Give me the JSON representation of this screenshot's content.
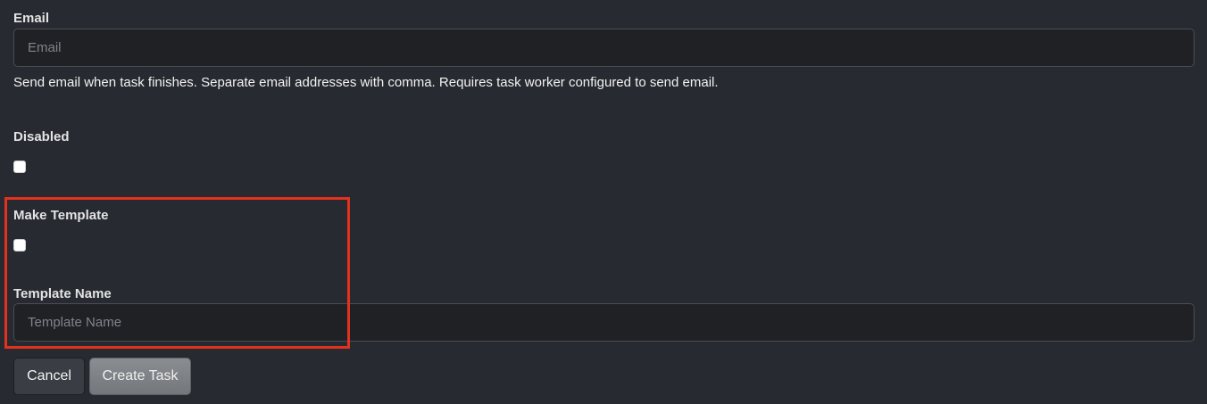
{
  "email": {
    "label": "Email",
    "placeholder": "Email",
    "value": "",
    "help": "Send email when task finishes. Separate email addresses with comma. Requires task worker configured to send email."
  },
  "disabled": {
    "label": "Disabled",
    "checked": false
  },
  "make_template": {
    "label": "Make Template",
    "checked": false
  },
  "template_name": {
    "label": "Template Name",
    "placeholder": "Template Name",
    "value": ""
  },
  "actions": {
    "cancel_label": "Cancel",
    "create_label": "Create Task"
  },
  "colors": {
    "background": "#272a30",
    "highlight": "#e2321e",
    "create_button": "#808387"
  }
}
